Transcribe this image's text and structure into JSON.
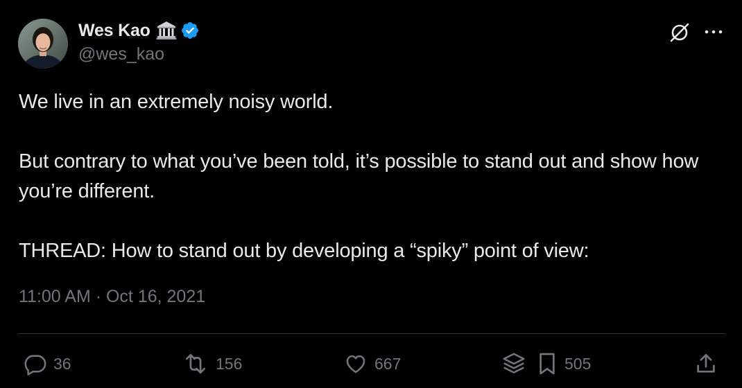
{
  "author": {
    "display_name": "Wes Kao",
    "handle": "@wes_kao",
    "name_emoji_icon": "classical-building-icon",
    "verified_icon": "verified-badge-icon",
    "verified_color": "#1d9bf0"
  },
  "header_actions": {
    "grok_icon": "grok-icon",
    "more_icon": "more-options-icon"
  },
  "tweet": {
    "line1": "We live in an extremely noisy world.",
    "line2": "But contrary to what you’ve been told, it’s possible to stand out and show how you’re different.",
    "line3": "THREAD: How to stand out by developing a “spiky” point of view:",
    "timestamp": "11:00 AM · Oct 16, 2021"
  },
  "actions": {
    "replies": "36",
    "reposts": "156",
    "likes": "667",
    "bookmarks": "505",
    "icons": [
      "reply-icon",
      "repost-icon",
      "like-icon",
      "layers-icon",
      "bookmark-icon",
      "share-icon"
    ]
  },
  "colors": {
    "background": "#000000",
    "text": "#e7e9ea",
    "secondary": "#71767b",
    "divider": "#2f3336",
    "accent": "#1d9bf0"
  }
}
